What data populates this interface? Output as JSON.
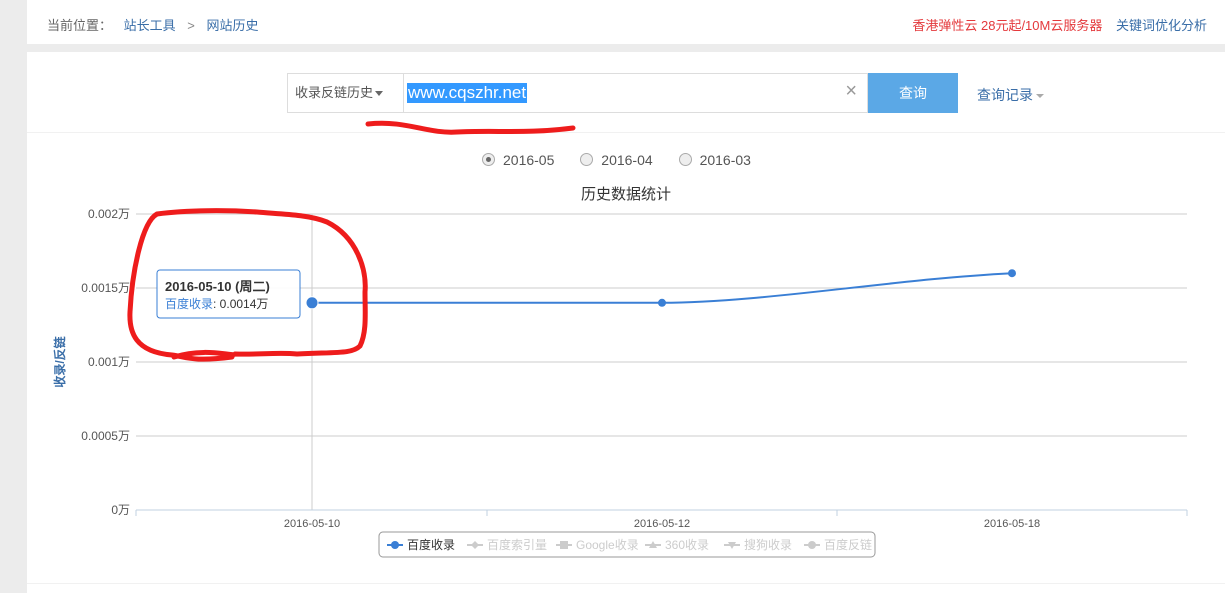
{
  "breadcrumb": {
    "prefix": "当前位置：",
    "item1": "站长工具",
    "sep": ">",
    "item2": "网站历史"
  },
  "top_links": {
    "ad": "香港弹性云 28元起/10M云服务器",
    "keyword": "关键词优化分析"
  },
  "search": {
    "type_label": "收录反链历史",
    "input_value": "www.cqszhr.net",
    "clear": "×",
    "button_label": "查询",
    "history_label": "查询记录"
  },
  "month_options": [
    {
      "label": "2016-05",
      "selected": true
    },
    {
      "label": "2016-04",
      "selected": false
    },
    {
      "label": "2016-03",
      "selected": false
    }
  ],
  "tooltip": {
    "date": "2016-05-10 (周二)",
    "series": "百度收录",
    "value": ": 0.0014万"
  },
  "legend": [
    {
      "label": "百度收录",
      "active": true,
      "marker": "circle"
    },
    {
      "label": "百度索引量",
      "active": false,
      "marker": "diamond"
    },
    {
      "label": "Google收录",
      "active": false,
      "marker": "square"
    },
    {
      "label": "360收录",
      "active": false,
      "marker": "triangle"
    },
    {
      "label": "搜狗收录",
      "active": false,
      "marker": "triangle-down"
    },
    {
      "label": "百度反链",
      "active": false,
      "marker": "circle"
    }
  ],
  "colors": {
    "series": "#3a7fd5",
    "annotation": "#ee1c1c",
    "button": "#5ba8e6"
  },
  "chart_data": {
    "type": "line",
    "title": "历史数据统计",
    "ylabel": "收录/反链",
    "xlabel": "",
    "categories": [
      "2016-05-10",
      "2016-05-12",
      "2016-05-18"
    ],
    "y_ticks": [
      "0万",
      "0.0005万",
      "0.001万",
      "0.0015万",
      "0.002万"
    ],
    "ylim": [
      0,
      0.002
    ],
    "grid": true,
    "series": [
      {
        "name": "百度收录",
        "values": [
          0.0014,
          0.0014,
          0.0016
        ]
      }
    ]
  }
}
